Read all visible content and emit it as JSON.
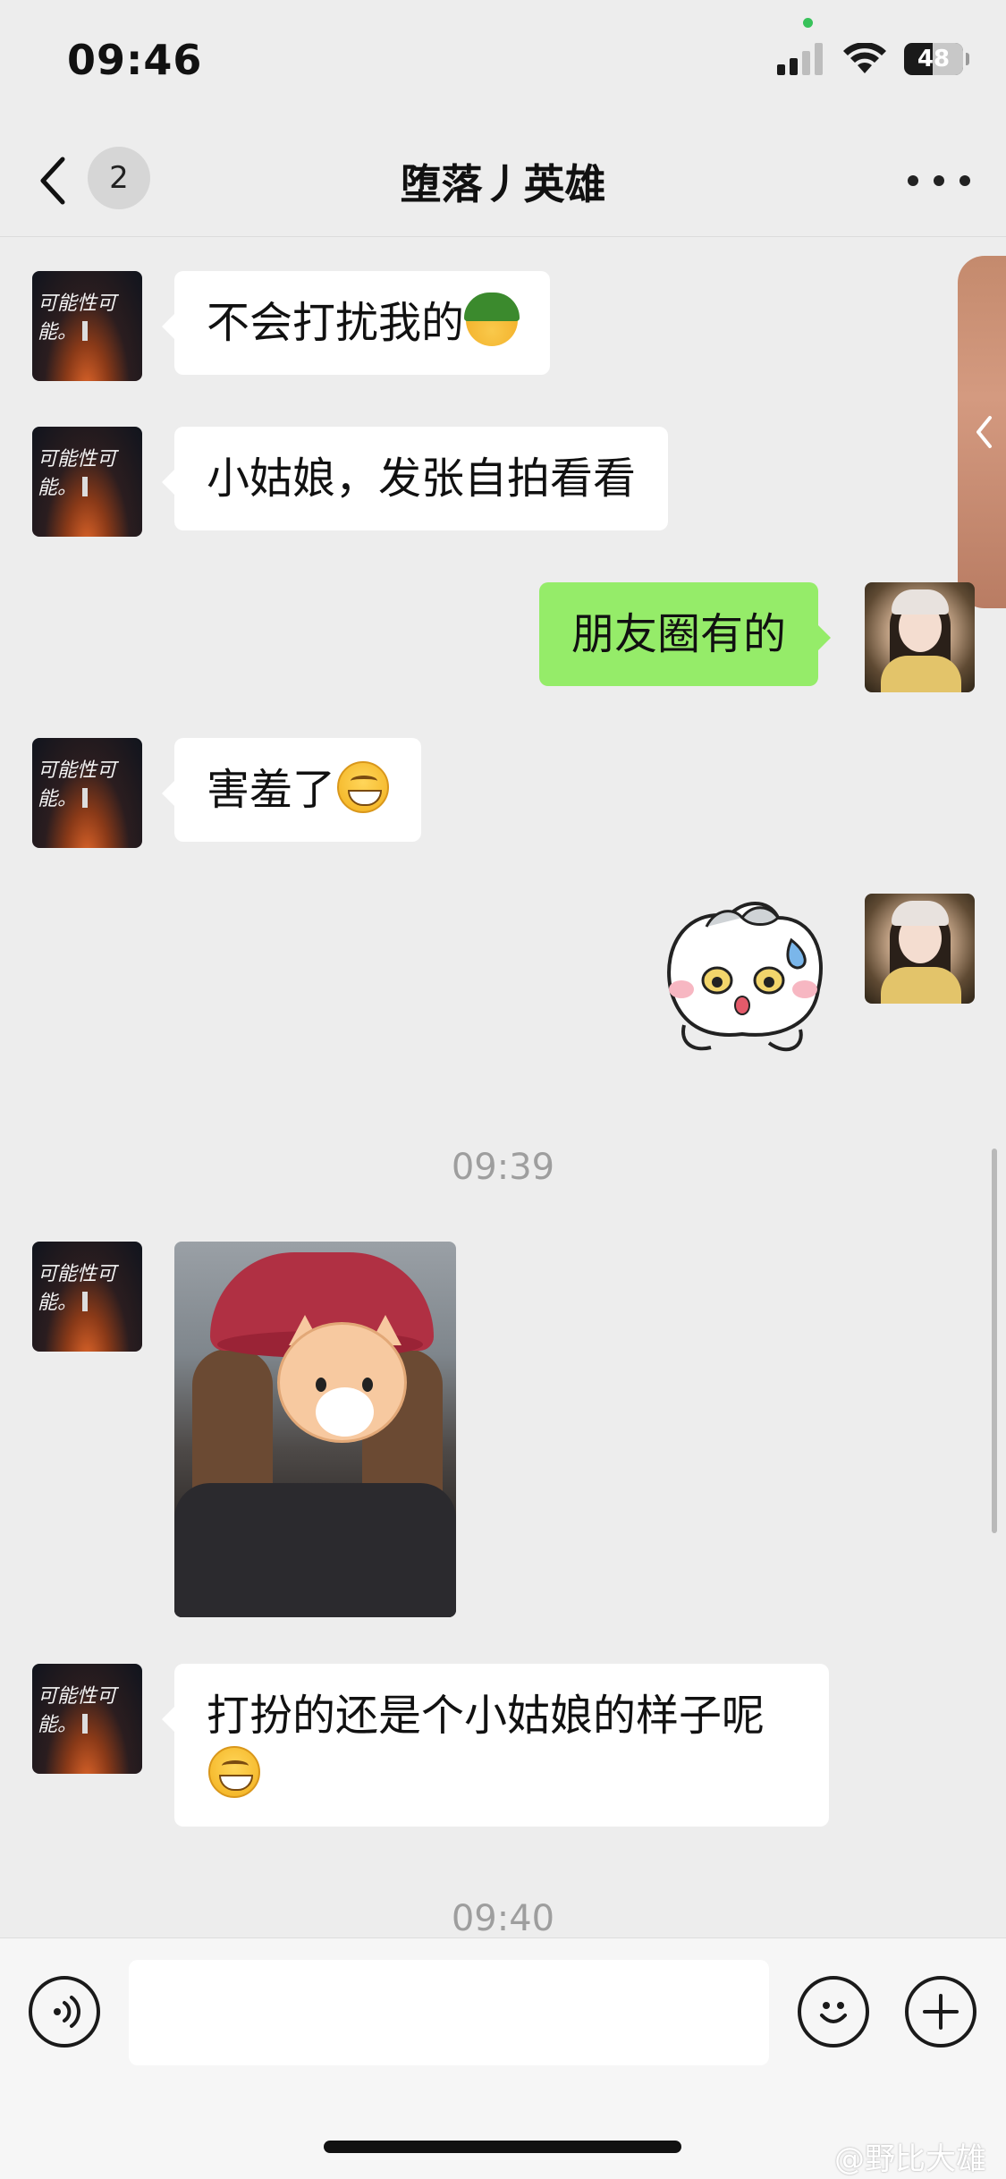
{
  "status_bar": {
    "time": "09:46",
    "battery": "48",
    "battery_level": 0.48
  },
  "nav": {
    "unread_count": "2",
    "title": "堕落丿英雄"
  },
  "messages": {
    "m1": "不会打扰我的",
    "m2": "小姑娘，发张自拍看看",
    "m3": "朋友圈有的",
    "m4": "害羞了",
    "m6": "打扮的还是个小姑娘的样子呢"
  },
  "contact_avatar_text": "可能性可能。",
  "timestamps": {
    "t1": "09:39",
    "t2": "09:40"
  },
  "input": {
    "value": "",
    "placeholder": ""
  },
  "watermark": "@野比大雄",
  "colors": {
    "outgoing_bubble": "#95ec69",
    "incoming_bubble": "#ffffff",
    "background": "#ededed"
  }
}
